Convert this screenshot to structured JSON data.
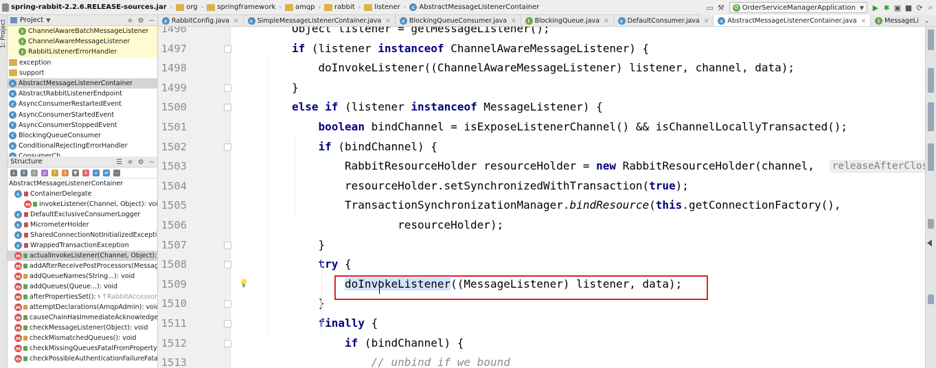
{
  "navbar": {
    "breadcrumbs": [
      "spring-rabbit-2.2.6.RELEASE-sources.jar",
      "org",
      "springframework",
      "amqp",
      "rabbit",
      "listener",
      "AbstractMessageListenerContainer"
    ],
    "run_config": "OrderServiceManagerApplication"
  },
  "left_strip": {
    "label": "1: Project"
  },
  "project": {
    "title": "Project",
    "items": [
      {
        "label": "ChannelAwareBatchMessageListener",
        "icon": "interface-icon",
        "indent": 1
      },
      {
        "label": "ChannelAwareMessageListener",
        "icon": "interface-icon",
        "indent": 1
      },
      {
        "label": "RabbitListenerErrorHandler",
        "icon": "interface-icon",
        "indent": 1
      },
      {
        "label": "exception",
        "icon": "folder-icon",
        "indent": 0
      },
      {
        "label": "support",
        "icon": "folder-icon",
        "indent": 0
      },
      {
        "label": "AbstractMessageListenerContainer",
        "icon": "class-icon",
        "indent": 0,
        "selected": true
      },
      {
        "label": "AbstractRabbitListenerEndpoint",
        "icon": "class-icon",
        "indent": 0
      },
      {
        "label": "AsyncConsumerRestartedEvent",
        "icon": "class-icon",
        "indent": 0
      },
      {
        "label": "AsyncConsumerStartedEvent",
        "icon": "class-icon",
        "indent": 0
      },
      {
        "label": "AsyncConsumerStoppedEvent",
        "icon": "class-icon",
        "indent": 0
      },
      {
        "label": "BlockingQueueConsumer",
        "icon": "class-icon",
        "indent": 0
      },
      {
        "label": "ConditionalRejectingErrorHandler",
        "icon": "class-icon",
        "indent": 0
      },
      {
        "label": "ConsumerCh...",
        "icon": "class-icon",
        "indent": 0
      }
    ]
  },
  "structure": {
    "title": "Structure",
    "items": [
      {
        "label": "AbstractMessageListenerContainer",
        "kind": "root"
      },
      {
        "label": "ContainerDelegate",
        "kind": "class"
      },
      {
        "label": "invokeListener(Channel, Object): void",
        "kind": "method",
        "indent": 1
      },
      {
        "label": "DefaultExclusiveConsumerLogger",
        "kind": "class"
      },
      {
        "label": "MicrometerHolder",
        "kind": "class"
      },
      {
        "label": "SharedConnectionNotInitializedException",
        "kind": "class"
      },
      {
        "label": "WrappedTransactionException",
        "kind": "class"
      },
      {
        "label": "actualInvokeListener(Channel, Object): void",
        "kind": "method",
        "selected": true
      },
      {
        "label": "addAfterReceivePostProcessors(MessagePostProcessor...)",
        "kind": "method"
      },
      {
        "label": "addQueueNames(String...): void",
        "kind": "method"
      },
      {
        "label": "addQueues(Queue...): void",
        "kind": "method"
      },
      {
        "label": "afterPropertiesSet(): void",
        "kind": "method",
        "hint": "↑RabbitAccessor"
      },
      {
        "label": "attemptDeclarations(AmqpAdmin): void",
        "kind": "method"
      },
      {
        "label": "causeChainHasImmediateAcknowledgeAmqpException",
        "kind": "method"
      },
      {
        "label": "checkMessageListener(Object): void",
        "kind": "method"
      },
      {
        "label": "checkMismatchedQueues(): void",
        "kind": "method"
      },
      {
        "label": "checkMissingQueuesFatalFromProperty(): void",
        "kind": "method"
      },
      {
        "label": "checkPossibleAuthenticationFailureFatalFromProperty",
        "kind": "method"
      }
    ]
  },
  "tabs": [
    {
      "label": "RabbitConfig.java",
      "active": false
    },
    {
      "label": "SimpleMessageListenerContainer.java",
      "active": false
    },
    {
      "label": "BlockingQueueConsumer.java",
      "active": false
    },
    {
      "label": "BlockingQueue.java",
      "active": false
    },
    {
      "label": "DefaultConsumer.java",
      "active": false
    },
    {
      "label": "AbstractMessageListenerContainer.java",
      "active": true
    },
    {
      "label": "MessageListenerContainer.java",
      "active": false
    }
  ],
  "editor": {
    "lines": [
      {
        "n": "1496",
        "indent": 2,
        "tokens": [
          [
            "Object listener = getMessageListener();",
            ""
          ]
        ]
      },
      {
        "n": "1497",
        "indent": 2,
        "tokens": [
          [
            "if",
            "kw"
          ],
          [
            " (listener ",
            ""
          ],
          [
            "instanceof",
            "kw"
          ],
          [
            " ChannelAwareMessageListener) {",
            ""
          ]
        ]
      },
      {
        "n": "1498",
        "indent": 3,
        "tokens": [
          [
            "doInvokeListener((ChannelAwareMessageListener) listener, channel, data);",
            ""
          ]
        ]
      },
      {
        "n": "1499",
        "indent": 2,
        "tokens": [
          [
            "}",
            ""
          ]
        ]
      },
      {
        "n": "1500",
        "indent": 2,
        "tokens": [
          [
            "else if",
            "kw"
          ],
          [
            " (listener ",
            ""
          ],
          [
            "instanceof",
            "kw"
          ],
          [
            " MessageListener) {",
            ""
          ]
        ]
      },
      {
        "n": "1501",
        "indent": 3,
        "tokens": [
          [
            "boolean",
            "kw"
          ],
          [
            " bindChannel = isExposeListenerChannel() && isChannelLocallyTransacted();",
            ""
          ]
        ]
      },
      {
        "n": "1502",
        "indent": 3,
        "tokens": [
          [
            "if",
            "kw"
          ],
          [
            " (bindChannel) {",
            ""
          ]
        ]
      },
      {
        "n": "1503",
        "indent": 4,
        "tokens": [
          [
            "RabbitResourceHolder resourceHolder = ",
            ""
          ],
          [
            "new",
            "kw"
          ],
          [
            " RabbitResourceHolder(channel, ",
            ""
          ],
          [
            "releaseAfterClose:",
            "hint"
          ]
        ]
      },
      {
        "n": "1504",
        "indent": 4,
        "tokens": [
          [
            "resourceHolder.setSynchronizedWithTransaction(",
            ""
          ],
          [
            "true",
            "kw"
          ],
          [
            ");",
            ""
          ]
        ]
      },
      {
        "n": "1505",
        "indent": 4,
        "tokens": [
          [
            "TransactionSynchronizationManager.",
            ""
          ],
          [
            "bindResource",
            "it"
          ],
          [
            "(",
            ""
          ],
          [
            "this",
            "kw"
          ],
          [
            ".getConnectionFactory(),",
            ""
          ]
        ]
      },
      {
        "n": "1506",
        "indent": 6,
        "tokens": [
          [
            "resourceHolder);",
            ""
          ]
        ]
      },
      {
        "n": "1507",
        "indent": 3,
        "tokens": [
          [
            "}",
            ""
          ]
        ]
      },
      {
        "n": "1508",
        "indent": 3,
        "tokens": [
          [
            "try",
            "kw"
          ],
          [
            " {",
            ""
          ]
        ]
      },
      {
        "n": "1509",
        "indent": 4,
        "tokens": [
          [
            "doInvokeListener",
            "sel"
          ],
          [
            "((MessageListener) listener, data);",
            ""
          ]
        ],
        "current": true
      },
      {
        "n": "1510",
        "indent": 3,
        "tokens": [
          [
            "}",
            ""
          ]
        ]
      },
      {
        "n": "1511",
        "indent": 3,
        "tokens": [
          [
            "finally",
            "kw"
          ],
          [
            " {",
            ""
          ]
        ]
      },
      {
        "n": "1512",
        "indent": 4,
        "tokens": [
          [
            "if",
            "kw"
          ],
          [
            " (bindChannel) {",
            ""
          ]
        ]
      },
      {
        "n": "1513",
        "indent": 5,
        "tokens": [
          [
            "// unbind if we bound",
            "cm"
          ]
        ]
      }
    ]
  },
  "colors": {
    "highlight_box": "#d8232a",
    "keyword": "#000080",
    "selection": "#d5d5d5"
  }
}
